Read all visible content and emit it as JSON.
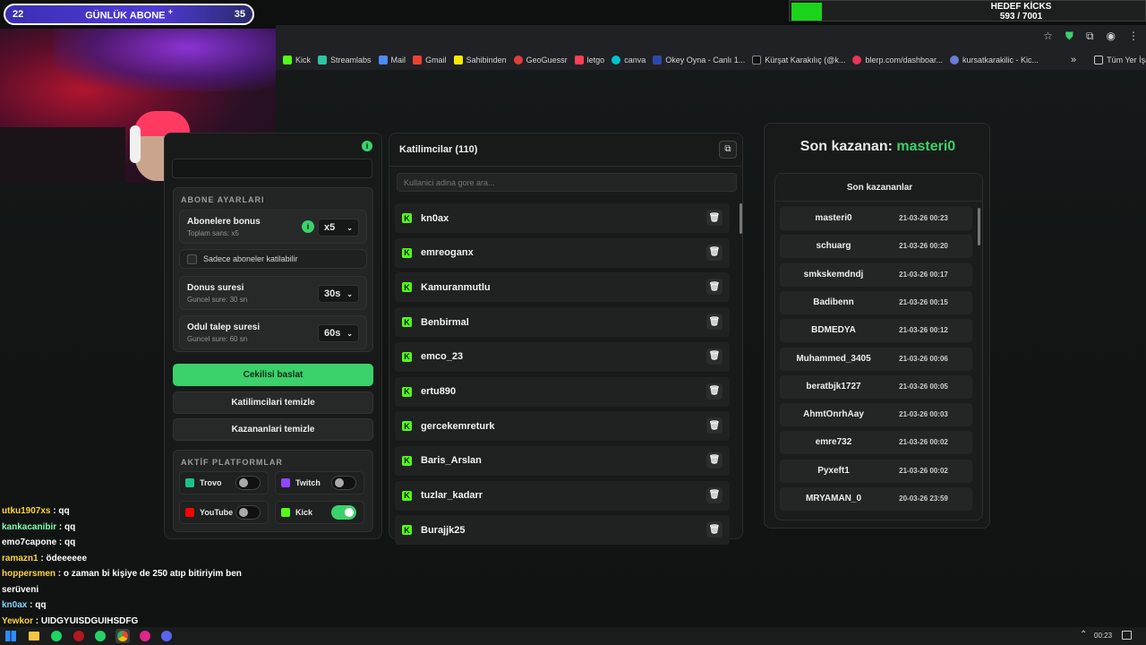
{
  "overlay": {
    "sub_left": "22",
    "sub_title": "GÜNLÜK ABONE",
    "sub_plus": "+",
    "sub_right": "35",
    "kicks_title": "HEDEF KİCKS",
    "kicks_progress": "593 / 7001",
    "kicks_fraction": 0.085
  },
  "bookmarks": [
    "Kick",
    "Streamlabs",
    "Mail",
    "Gmail",
    "Sahibinden",
    "GeoGuessr",
    "letgo",
    "canva",
    "Okey Oyna - Canlı 1...",
    "Kürşat Karakılıç (@k...",
    "blerp.com/dashboar...",
    "kursatkarakilic - Kic..."
  ],
  "bookmark_more": "»",
  "bookmark_all": "Tüm Yer İşaretleri",
  "settings": {
    "abone_title": "ABONE AYARLARI",
    "bonus_title": "Abonelere bonus",
    "bonus_sub": "Toplam sans: x5",
    "bonus_value": "x5",
    "only_subs": "Sadece aboneler katilabilir",
    "donus_title": "Donus suresi",
    "donus_sub": "Guncel sure: 30 sn",
    "donus_value": "30s",
    "odul_title": "Odul talep suresi",
    "odul_sub": "Guncel sure: 60 sn",
    "odul_value": "60s",
    "start": "Cekilisi baslat",
    "clear_participants": "Katilimcilari temizle",
    "clear_winners": "Kazananlari temizle",
    "platforms_title": "AKTİF PLATFORMLAR",
    "platforms": [
      {
        "name": "Trovo",
        "on": false
      },
      {
        "name": "Twitch",
        "on": false
      },
      {
        "name": "YouTube",
        "on": false
      },
      {
        "name": "Kick",
        "on": true
      }
    ]
  },
  "participants": {
    "title": "Katilimcilar (110)",
    "search_placeholder": "Kullanici adina gore ara...",
    "items": [
      "kn0ax",
      "emreoganx",
      "Kamuranmutlu",
      "Benbirmal",
      "emco_23",
      "ertu890",
      "gercekemreturk",
      "Baris_Arslan",
      "tuzlar_kadarr",
      "Burajjk25"
    ]
  },
  "winners": {
    "last_label": "Son kazanan:",
    "last_name": "masteri0",
    "list_title": "Son kazananlar",
    "items": [
      {
        "name": "masteri0",
        "date": "21-03-26 00:23"
      },
      {
        "name": "schuarg",
        "date": "21-03-26 00:20"
      },
      {
        "name": "smkskemdndj",
        "date": "21-03-26 00:17"
      },
      {
        "name": "Badibenn",
        "date": "21-03-26 00:15"
      },
      {
        "name": "BDMEDYA",
        "date": "21-03-26 00:12"
      },
      {
        "name": "Muhammed_3405",
        "date": "21-03-26 00:06"
      },
      {
        "name": "beratbjk1727",
        "date": "21-03-26 00:05"
      },
      {
        "name": "AhmtOnrhAay",
        "date": "21-03-26 00:03"
      },
      {
        "name": "emre732",
        "date": "21-03-26 00:02"
      },
      {
        "name": "Pyxeft1",
        "date": "21-03-26 00:02"
      },
      {
        "name": "MRYAMAN_0",
        "date": "20-03-26 23:59"
      }
    ]
  },
  "chat": [
    {
      "user": "utku1907xs",
      "msg": " : qq",
      "color": "#ffd23f"
    },
    {
      "user": "kankacanibir",
      "msg": " : qq",
      "color": "#7fffb0"
    },
    {
      "user": "emo7capone",
      "msg": " : qq",
      "color": "#ffffff"
    },
    {
      "user": "ramazn1",
      "msg": " : ödeeeeee",
      "color": "#ffd23f"
    },
    {
      "user": "hoppersmen",
      "msg": " : o zaman bi kişiye de 250 atıp bitiriyim ben serüveni",
      "color": "#ffd23f"
    },
    {
      "user": "kn0ax",
      "msg": " : qq",
      "color": "#7fd7ff"
    },
    {
      "user": "Yewkor",
      "msg": " : UIDGYUISDGUIHSDFG",
      "color": "#ffd23f"
    }
  ],
  "taskbar_time": "00:23",
  "colors": {
    "accent": "#3bd16b",
    "kick": "#53fc18"
  }
}
